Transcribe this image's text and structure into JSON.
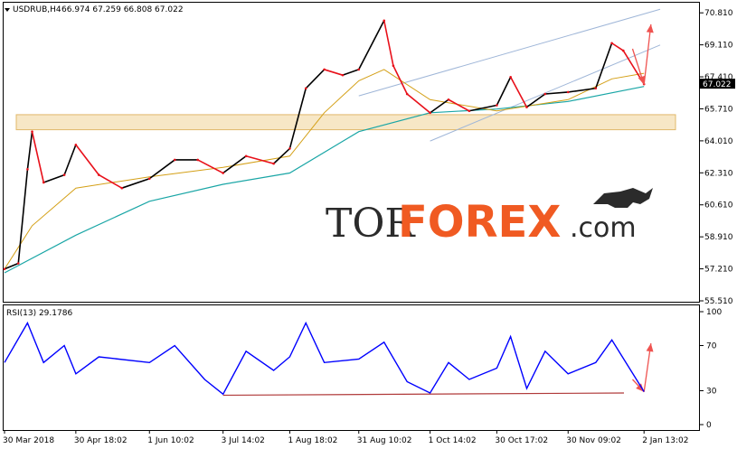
{
  "header": {
    "symbol": "USDRUB,H4",
    "ohlc": "66.974 67.259 66.808 67.022"
  },
  "watermark": {
    "part1": "TOR",
    "part2": "FOREX",
    "part3": ".com"
  },
  "rsi_header": {
    "label": "RSI(13) 29.1786"
  },
  "current_price_tag": "67.022",
  "colors": {
    "bull_candle": "#000000",
    "bear_candle": "#e8101a",
    "ma_fast": "#d4a017",
    "ma_slow": "#1aa6a6",
    "channel": "#9fb6d8",
    "support_zone_fill": "#f7e7c6",
    "support_zone_stroke": "#e0b86a",
    "rsi_line": "#0000ff",
    "rsi_support": "#b03a3a",
    "forecast_arrow": "#ef5350"
  },
  "chart_data": [
    {
      "type": "candlestick",
      "title": "USDRUB,H4",
      "y_ticks": [
        "70.810",
        "69.110",
        "67.410",
        "65.710",
        "64.010",
        "62.310",
        "60.610",
        "58.910",
        "57.210",
        "55.510"
      ],
      "ylim": [
        55.51,
        71.3
      ],
      "x_ticks": [
        "30 Mar 2018",
        "30 Apr 18:02",
        "1 Jun 10:02",
        "3 Jul 14:02",
        "1 Aug 18:02",
        "31 Aug 10:02",
        "1 Oct 14:02",
        "30 Oct 17:02",
        "30 Nov 09:02",
        "2 Jan 13:02"
      ],
      "price_path": [
        {
          "x": "30 Mar 2018",
          "y": 57.2
        },
        {
          "x": "5 Apr",
          "y": 57.5
        },
        {
          "x": "9 Apr",
          "y": 62.5
        },
        {
          "x": "11 Apr",
          "y": 64.5
        },
        {
          "x": "16 Apr",
          "y": 61.8
        },
        {
          "x": "25 Apr",
          "y": 62.2
        },
        {
          "x": "30 Apr 18:02",
          "y": 63.8
        },
        {
          "x": "10 May",
          "y": 62.2
        },
        {
          "x": "20 May",
          "y": 61.5
        },
        {
          "x": "1 Jun 10:02",
          "y": 62.0
        },
        {
          "x": "12 Jun",
          "y": 63.0
        },
        {
          "x": "22 Jun",
          "y": 63.0
        },
        {
          "x": "3 Jul 14:02",
          "y": 62.3
        },
        {
          "x": "13 Jul",
          "y": 63.2
        },
        {
          "x": "25 Jul",
          "y": 62.8
        },
        {
          "x": "1 Aug 18:02",
          "y": 63.6
        },
        {
          "x": "8 Aug",
          "y": 66.8
        },
        {
          "x": "16 Aug",
          "y": 67.8
        },
        {
          "x": "24 Aug",
          "y": 67.5
        },
        {
          "x": "31 Aug 10:02",
          "y": 67.8
        },
        {
          "x": "11 Sep",
          "y": 70.4
        },
        {
          "x": "15 Sep",
          "y": 68.0
        },
        {
          "x": "21 Sep",
          "y": 66.5
        },
        {
          "x": "1 Oct 14:02",
          "y": 65.5
        },
        {
          "x": "9 Oct",
          "y": 66.2
        },
        {
          "x": "18 Oct",
          "y": 65.6
        },
        {
          "x": "30 Oct 17:02",
          "y": 65.9
        },
        {
          "x": "5 Nov",
          "y": 67.4
        },
        {
          "x": "12 Nov",
          "y": 65.8
        },
        {
          "x": "20 Nov",
          "y": 66.5
        },
        {
          "x": "30 Nov 09:02",
          "y": 66.6
        },
        {
          "x": "12 Dec",
          "y": 66.8
        },
        {
          "x": "19 Dec",
          "y": 69.2
        },
        {
          "x": "24 Dec",
          "y": 68.8
        },
        {
          "x": "2 Jan 13:02",
          "y": 67.022
        }
      ],
      "ma_fast": [
        {
          "x": "30 Mar 2018",
          "y": 57.2
        },
        {
          "x": "11 Apr",
          "y": 59.5
        },
        {
          "x": "30 Apr 18:02",
          "y": 61.5
        },
        {
          "x": "1 Jun 10:02",
          "y": 62.1
        },
        {
          "x": "3 Jul 14:02",
          "y": 62.6
        },
        {
          "x": "1 Aug 18:02",
          "y": 63.2
        },
        {
          "x": "16 Aug",
          "y": 65.5
        },
        {
          "x": "31 Aug 10:02",
          "y": 67.2
        },
        {
          "x": "11 Sep",
          "y": 67.8
        },
        {
          "x": "1 Oct 14:02",
          "y": 66.2
        },
        {
          "x": "30 Oct 17:02",
          "y": 65.6
        },
        {
          "x": "30 Nov 09:02",
          "y": 66.2
        },
        {
          "x": "19 Dec",
          "y": 67.3
        },
        {
          "x": "2 Jan 13:02",
          "y": 67.6
        }
      ],
      "ma_slow": [
        {
          "x": "30 Mar 2018",
          "y": 57.0
        },
        {
          "x": "30 Apr 18:02",
          "y": 59.0
        },
        {
          "x": "1 Jun 10:02",
          "y": 60.8
        },
        {
          "x": "3 Jul 14:02",
          "y": 61.7
        },
        {
          "x": "1 Aug 18:02",
          "y": 62.3
        },
        {
          "x": "31 Aug 10:02",
          "y": 64.5
        },
        {
          "x": "1 Oct 14:02",
          "y": 65.5
        },
        {
          "x": "30 Oct 17:02",
          "y": 65.7
        },
        {
          "x": "30 Nov 09:02",
          "y": 66.1
        },
        {
          "x": "2 Jan 13:02",
          "y": 66.9
        }
      ],
      "support_zone": [
        64.6,
        65.4
      ],
      "channel_upper": [
        {
          "x": "31 Aug 10:02",
          "y": 66.4
        },
        {
          "x": "9 Jan",
          "y": 71.0
        }
      ],
      "channel_lower": [
        {
          "x": "1 Oct 14:02",
          "y": 64.0
        },
        {
          "x": "9 Jan",
          "y": 69.1
        }
      ],
      "forecast_arrows": [
        {
          "from": {
            "x": "28 Dec",
            "y": 68.9
          },
          "to": {
            "x": "2 Jan 13:02",
            "y": 67.0
          }
        },
        {
          "from": {
            "x": "2 Jan 13:02",
            "y": 67.0
          },
          "to": {
            "x": "5 Jan",
            "y": 70.2
          }
        }
      ]
    },
    {
      "type": "line",
      "title": "RSI(13) 29.1786",
      "y_ticks": [
        "100",
        "70",
        "30",
        "0"
      ],
      "ylim": [
        0,
        100
      ],
      "values": [
        {
          "x": "30 Mar 2018",
          "y": 55
        },
        {
          "x": "9 Apr",
          "y": 90
        },
        {
          "x": "16 Apr",
          "y": 55
        },
        {
          "x": "25 Apr",
          "y": 70
        },
        {
          "x": "30 Apr 18:02",
          "y": 45
        },
        {
          "x": "10 May",
          "y": 60
        },
        {
          "x": "1 Jun 10:02",
          "y": 55
        },
        {
          "x": "12 Jun",
          "y": 70
        },
        {
          "x": "25 Jun",
          "y": 40
        },
        {
          "x": "3 Jul 14:02",
          "y": 27
        },
        {
          "x": "13 Jul",
          "y": 65
        },
        {
          "x": "25 Jul",
          "y": 48
        },
        {
          "x": "1 Aug 18:02",
          "y": 60
        },
        {
          "x": "8 Aug",
          "y": 90
        },
        {
          "x": "16 Aug",
          "y": 55
        },
        {
          "x": "31 Aug 10:02",
          "y": 58
        },
        {
          "x": "11 Sep",
          "y": 73
        },
        {
          "x": "21 Sep",
          "y": 38
        },
        {
          "x": "1 Oct 14:02",
          "y": 28
        },
        {
          "x": "9 Oct",
          "y": 55
        },
        {
          "x": "18 Oct",
          "y": 40
        },
        {
          "x": "30 Oct 17:02",
          "y": 50
        },
        {
          "x": "5 Nov",
          "y": 78
        },
        {
          "x": "12 Nov",
          "y": 32
        },
        {
          "x": "20 Nov",
          "y": 65
        },
        {
          "x": "30 Nov 09:02",
          "y": 45
        },
        {
          "x": "12 Dec",
          "y": 55
        },
        {
          "x": "19 Dec",
          "y": 75
        },
        {
          "x": "2 Jan 13:02",
          "y": 29.18
        }
      ],
      "support_line": [
        {
          "x": "3 Jul 14:02",
          "y": 26
        },
        {
          "x": "9 Jan",
          "y": 28
        }
      ],
      "forecast_arrows": [
        {
          "from": {
            "x": "28 Dec",
            "y": 40
          },
          "to": {
            "x": "2 Jan 13:02",
            "y": 29
          }
        },
        {
          "from": {
            "x": "2 Jan 13:02",
            "y": 29
          },
          "to": {
            "x": "5 Jan",
            "y": 72
          }
        }
      ]
    }
  ]
}
